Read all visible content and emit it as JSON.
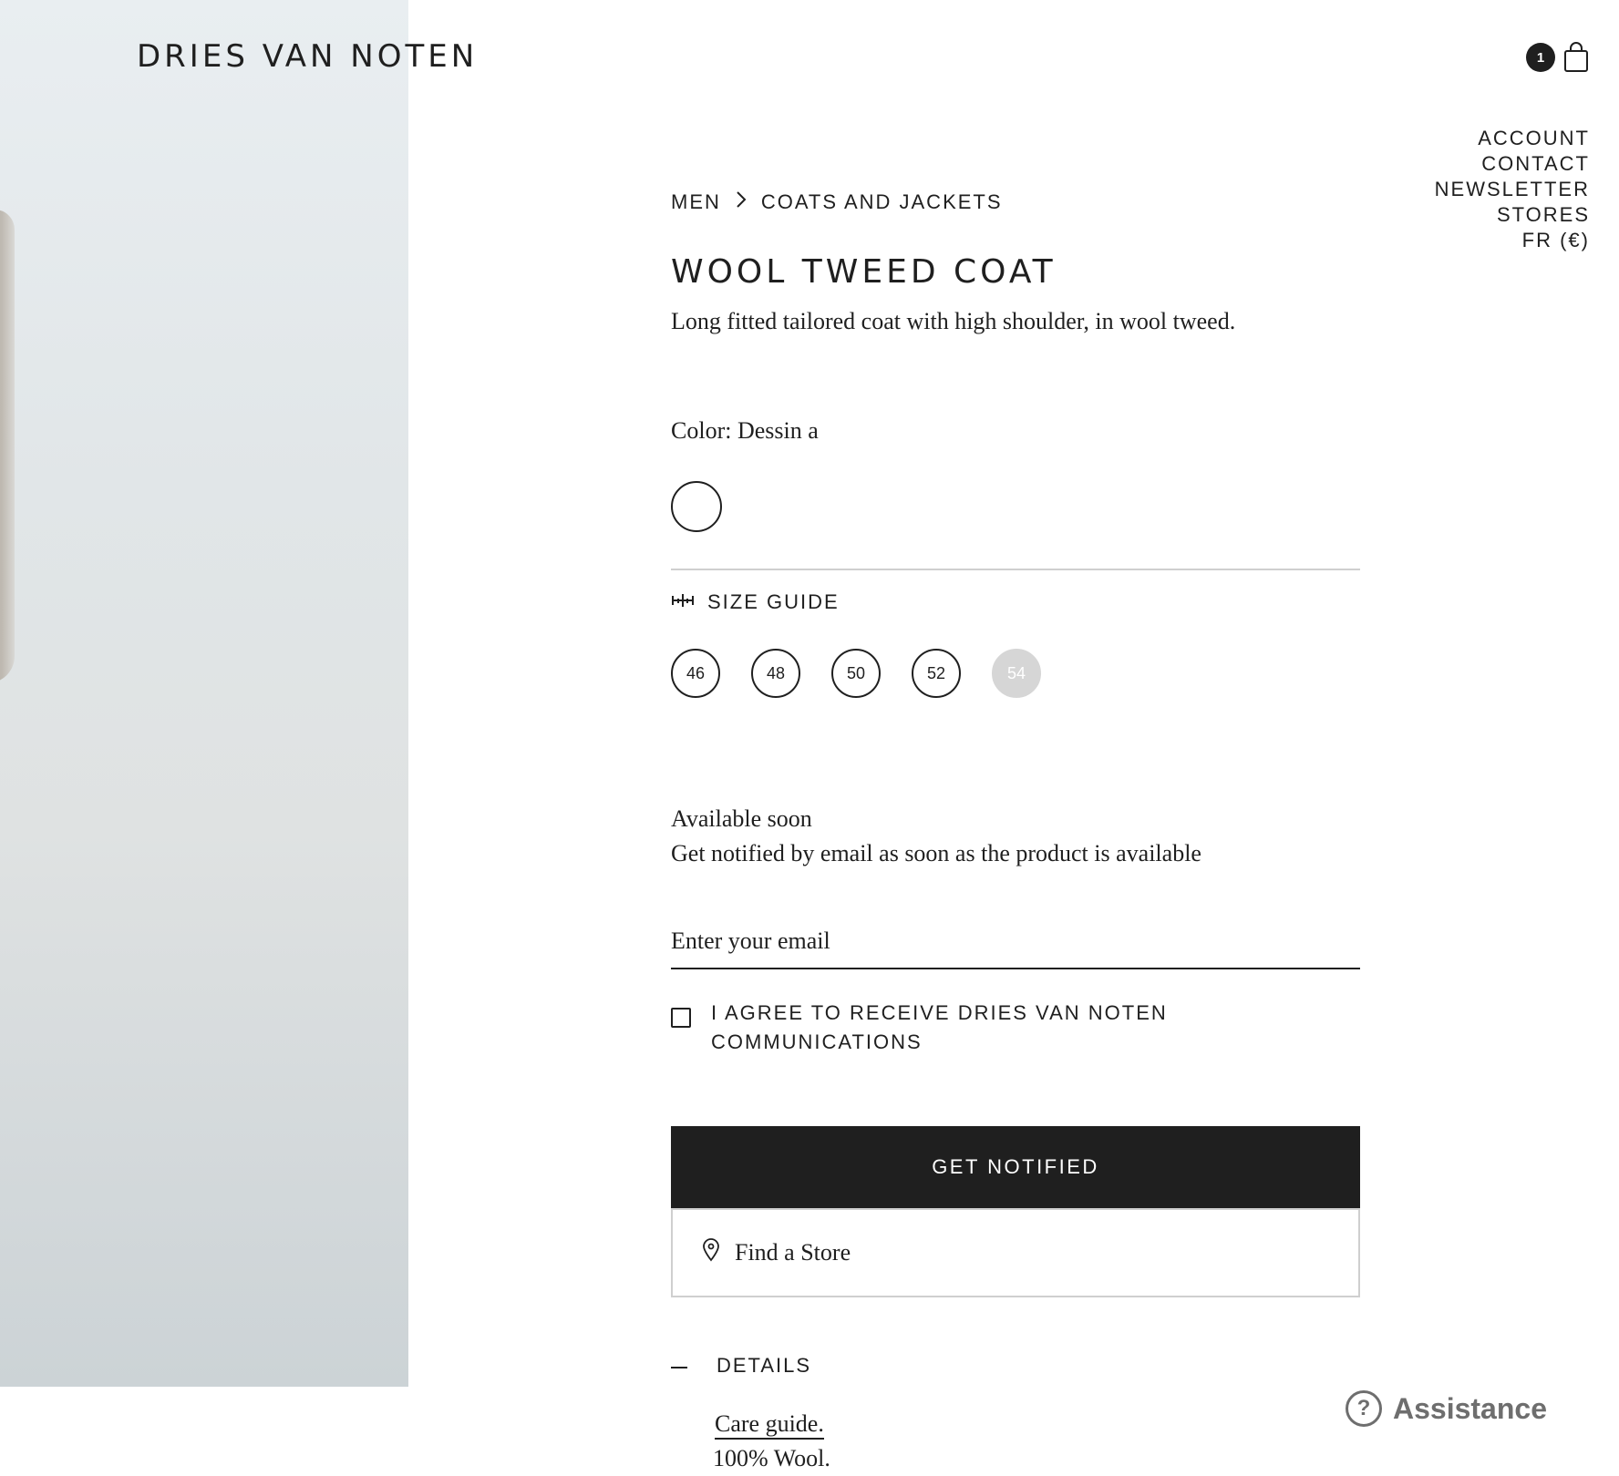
{
  "header": {
    "logo": "DRIES VAN NOTEN",
    "cart_count": "1"
  },
  "utility_nav": [
    "ACCOUNT",
    "CONTACT",
    "NEWSLETTER",
    "STORES",
    "FR (€)"
  ],
  "breadcrumb": {
    "parent": "MEN",
    "current": "COATS AND JACKETS"
  },
  "product": {
    "title": "WOOL TWEED COAT",
    "description": "Long fitted tailored coat with high shoulder, in wool tweed.",
    "color_label": "Color: Dessin a"
  },
  "size_guide_label": "SIZE GUIDE",
  "sizes": [
    {
      "label": "46",
      "available": true
    },
    {
      "label": "48",
      "available": true
    },
    {
      "label": "50",
      "available": true
    },
    {
      "label": "52",
      "available": true
    },
    {
      "label": "54",
      "available": false
    }
  ],
  "availability": {
    "title": "Available soon",
    "subtitle": "Get notified by email as soon as the product is available"
  },
  "email": {
    "placeholder": "Enter your email",
    "value": ""
  },
  "consent_label": "I AGREE TO RECEIVE DRIES VAN NOTEN COMMUNICATIONS",
  "buttons": {
    "notify": "GET NOTIFIED",
    "find_store": "Find a Store"
  },
  "details": {
    "heading": "DETAILS",
    "care_link": "Care guide.",
    "composition": "100% Wool."
  },
  "assistance": {
    "label": "Assistance",
    "icon": "question-icon"
  },
  "colors": {
    "text": "#1f1f1f",
    "button_bg": "#1f1f1f",
    "disabled_size": "#d6d6d6",
    "assistance": "#6e6e6e"
  }
}
